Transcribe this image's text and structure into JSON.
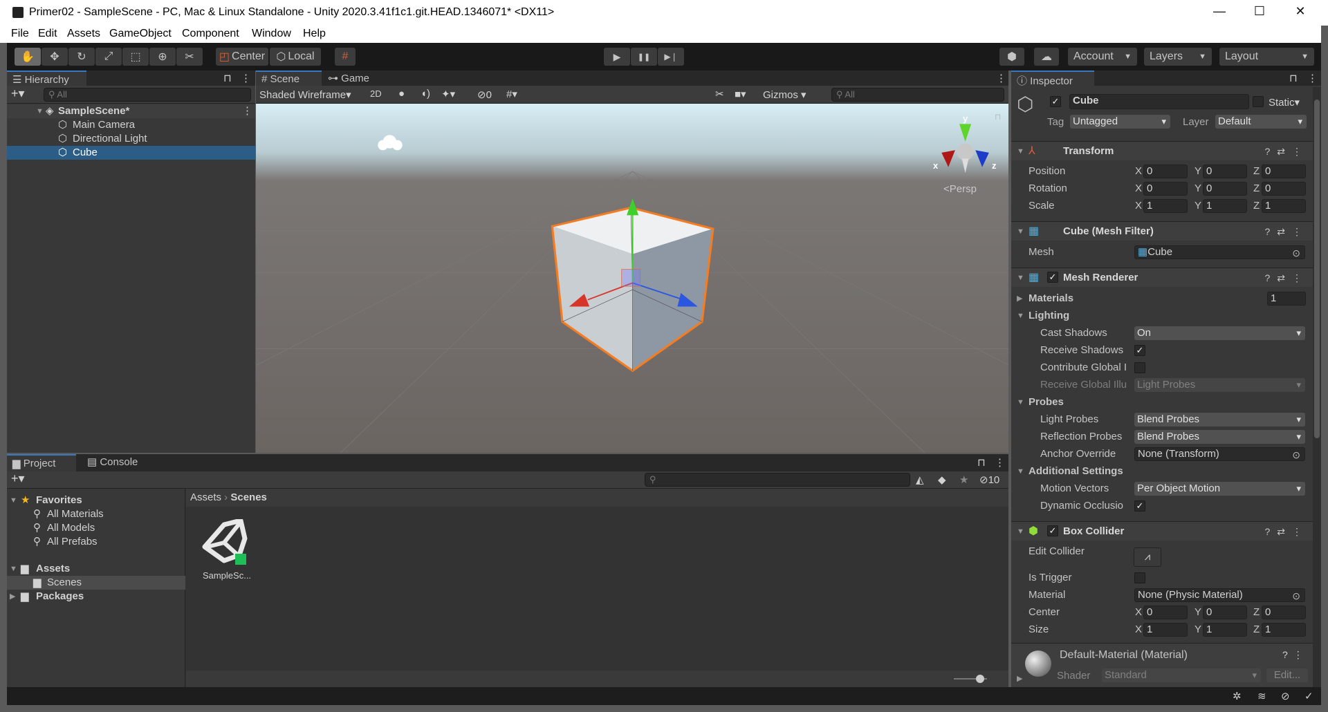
{
  "window": {
    "title": "Primer02 - SampleScene - PC, Mac & Linux Standalone - Unity 2020.3.41f1c1.git.HEAD.1346071* <DX11>",
    "minimize": "—",
    "maximize": "☐",
    "close": "✕"
  },
  "menu": [
    "File",
    "Edit",
    "Assets",
    "GameObject",
    "Component",
    "Window",
    "Help"
  ],
  "toolbar": {
    "tools": [
      "hand-tool",
      "move-tool",
      "rotate-tool",
      "scale-tool",
      "rect-tool",
      "transform-tool",
      "custom-tool"
    ],
    "tool_glyphs": [
      "✋",
      "✥",
      "↻",
      "⤢",
      "⬚",
      "⊕",
      "✂"
    ],
    "pivot": "Center",
    "space": "Local",
    "play": "▶",
    "pause": "❚❚",
    "step": "▶❘",
    "account": "Account",
    "layers": "Layers",
    "layout": "Layout"
  },
  "hierarchy": {
    "tab": "Hierarchy",
    "search_placeholder": "All",
    "scene": "SampleScene*",
    "items": [
      "Main Camera",
      "Directional Light",
      "Cube"
    ],
    "selected": "Cube"
  },
  "scene": {
    "tabs": [
      "Scene",
      "Game"
    ],
    "draw_mode": "Shaded Wireframe",
    "mode_2d": "2D",
    "hidden_count": "0",
    "gizmos": "Gizmos",
    "search_placeholder": "All",
    "projection": "Persp",
    "axis_labels": {
      "x": "x",
      "y": "y",
      "z": "z"
    },
    "selection_color": "#f57c20"
  },
  "inspector": {
    "tab": "Inspector",
    "object_name": "Cube",
    "active": true,
    "static_label": "Static",
    "tag_label": "Tag",
    "tag": "Untagged",
    "layer_label": "Layer",
    "layer": "Default",
    "transform": {
      "title": "Transform",
      "rows": [
        {
          "label": "Position",
          "x": "0",
          "y": "0",
          "z": "0"
        },
        {
          "label": "Rotation",
          "x": "0",
          "y": "0",
          "z": "0"
        },
        {
          "label": "Scale",
          "x": "1",
          "y": "1",
          "z": "1"
        }
      ]
    },
    "mesh_filter": {
      "title": "Cube (Mesh Filter)",
      "mesh_label": "Mesh",
      "mesh": "Cube"
    },
    "mesh_renderer": {
      "title": "Mesh Renderer",
      "materials": "Materials",
      "materials_count": "1",
      "lighting": "Lighting",
      "cast_shadows_label": "Cast Shadows",
      "cast_shadows": "On",
      "receive_shadows_label": "Receive Shadows",
      "receive_shadows": true,
      "contribute_gi_label": "Contribute Global I",
      "contribute_gi": false,
      "receive_gi_label": "Receive Global Illu",
      "receive_gi": "Light Probes",
      "probes": "Probes",
      "light_probes_label": "Light Probes",
      "light_probes": "Blend Probes",
      "reflection_probes_label": "Reflection Probes",
      "reflection_probes": "Blend Probes",
      "anchor_label": "Anchor Override",
      "anchor": "None (Transform)",
      "additional": "Additional Settings",
      "motion_vectors_label": "Motion Vectors",
      "motion_vectors": "Per Object Motion",
      "dynamic_occlusion_label": "Dynamic Occlusio",
      "dynamic_occlusion": true
    },
    "box_collider": {
      "title": "Box Collider",
      "edit_collider": "Edit Collider",
      "is_trigger_label": "Is Trigger",
      "is_trigger": false,
      "material_label": "Material",
      "material": "None (Physic Material)",
      "center": {
        "label": "Center",
        "x": "0",
        "y": "0",
        "z": "0"
      },
      "size": {
        "label": "Size",
        "x": "1",
        "y": "1",
        "z": "1"
      }
    },
    "material": {
      "title": "Default-Material (Material)",
      "shader_label": "Shader",
      "shader": "Standard",
      "edit": "Edit..."
    }
  },
  "project": {
    "tabs": [
      "Project",
      "Console"
    ],
    "hidden_count": "10",
    "favorites": "Favorites",
    "fav_items": [
      "All Materials",
      "All Models",
      "All Prefabs"
    ],
    "assets": "Assets",
    "scenes": "Scenes",
    "packages": "Packages",
    "breadcrumb": [
      "Assets",
      "Scenes"
    ],
    "files": [
      {
        "name": "SampleSc..."
      }
    ]
  }
}
